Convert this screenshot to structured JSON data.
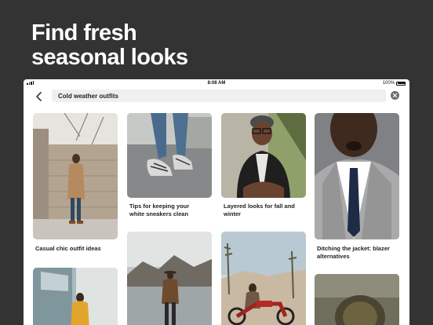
{
  "promo": {
    "headline": "Find fresh\nseasonal looks"
  },
  "status_bar": {
    "time": "8:08 AM",
    "battery": "100%"
  },
  "search": {
    "query": "Cold weather outfits"
  },
  "pins": [
    {
      "caption": "Casual chic outfit ideas"
    },
    {
      "caption": "Tips for keeping your\nwhite sneakers clean"
    },
    {
      "caption": "Layered looks for fall and\nwinter"
    },
    {
      "caption": "Ditching the jacket: blazer\nalternatives"
    },
    {
      "caption": ""
    },
    {
      "caption": ""
    },
    {
      "caption": ""
    },
    {
      "caption": ""
    }
  ],
  "icons": [
    "back-arrow-icon",
    "clear-search-icon",
    "signal-icon",
    "battery-icon"
  ],
  "colors": {
    "background": "#333333",
    "search_field": "#efefef",
    "text": "#222222"
  }
}
